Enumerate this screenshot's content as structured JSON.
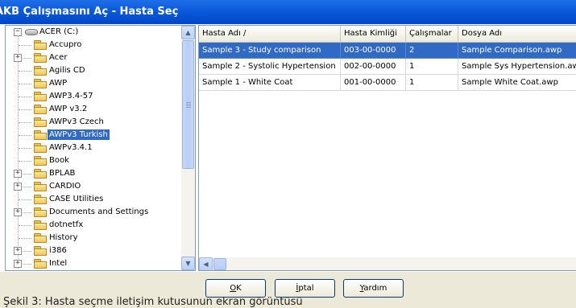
{
  "window": {
    "title": "AKB Çalışmasını Aç - Hasta Seç"
  },
  "tree": {
    "root": "ACER (C:)",
    "items": [
      {
        "label": "Accupro",
        "expandable": false
      },
      {
        "label": "Acer",
        "expandable": true
      },
      {
        "label": "Agilis CD",
        "expandable": false
      },
      {
        "label": "AWP",
        "expandable": false
      },
      {
        "label": "AWP3.4-57",
        "expandable": false
      },
      {
        "label": "AWP v3.2",
        "expandable": false
      },
      {
        "label": "AWPv3 Czech",
        "expandable": false
      },
      {
        "label": "AWPv3 Turkish",
        "expandable": false,
        "selected": true
      },
      {
        "label": "AWPv3.4.1",
        "expandable": false
      },
      {
        "label": "Book",
        "expandable": false
      },
      {
        "label": "BPLAB",
        "expandable": true
      },
      {
        "label": "CARDIO",
        "expandable": true
      },
      {
        "label": "CASE Utilities",
        "expandable": false
      },
      {
        "label": "Documents and Settings",
        "expandable": true
      },
      {
        "label": "dotnetfx",
        "expandable": false
      },
      {
        "label": "History",
        "expandable": false
      },
      {
        "label": "i386",
        "expandable": true
      },
      {
        "label": "Intel",
        "expandable": true
      }
    ]
  },
  "table": {
    "columns": [
      "Hasta Adı /",
      "Hasta Kimliği",
      "Çalışmalar",
      "Dosya Adı"
    ],
    "rows": [
      [
        "Sample 3 - Study comparison",
        "003-00-0000",
        "2",
        "Sample Comparison.awp"
      ],
      [
        "Sample 2 - Systolic Hypertension",
        "002-00-0000",
        "1",
        "Sample Sys Hypertension.awp"
      ],
      [
        "Sample 1 - White Coat",
        "001-00-0000",
        "1",
        "Sample White Coat.awp"
      ]
    ],
    "selected_row": 0
  },
  "buttons": {
    "ok": {
      "mnemonic": "O",
      "rest": "K"
    },
    "cancel": {
      "mnemonic": "İ",
      "rest": "ptal"
    },
    "help": {
      "mnemonic": "Y",
      "rest": "ardım"
    }
  },
  "status": {
    "text": "Şekil 3: Hasta seçme iletişim kutusunun ekran görüntüsü"
  }
}
